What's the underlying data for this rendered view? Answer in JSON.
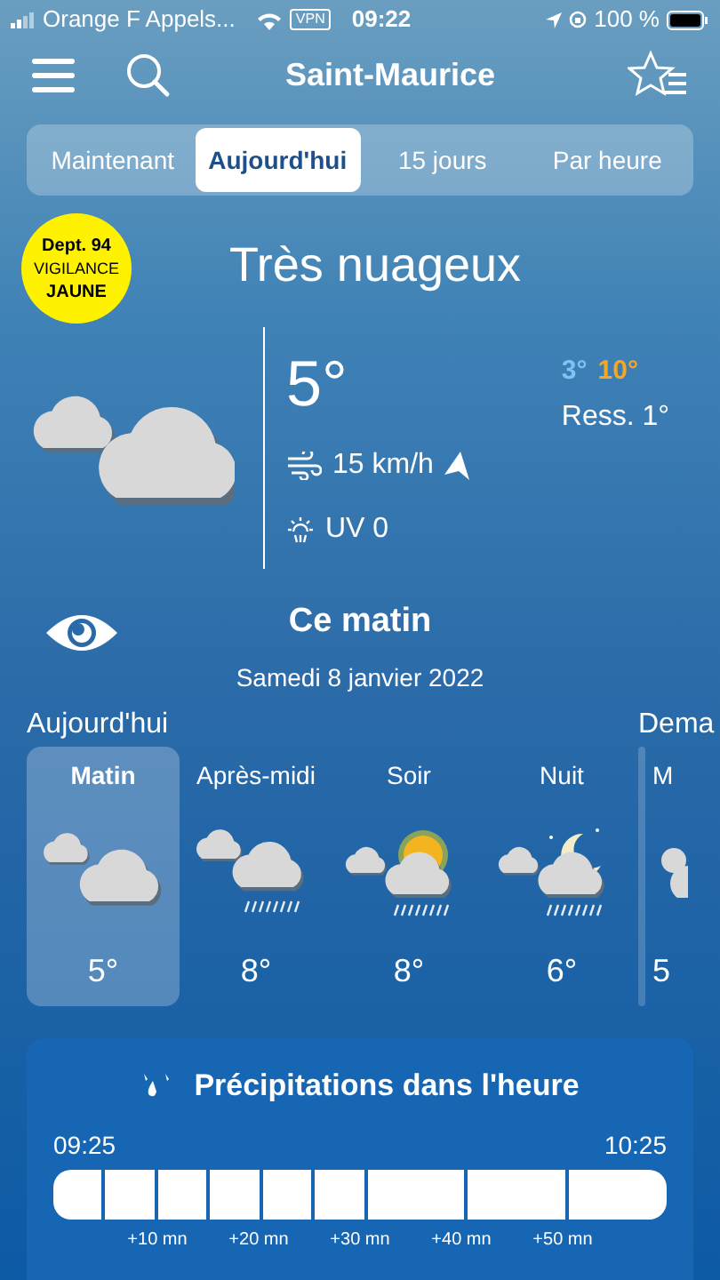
{
  "status_bar": {
    "carrier": "Orange F Appels...",
    "vpn": "VPN",
    "time": "09:22",
    "battery": "100 %"
  },
  "header": {
    "title": "Saint-Maurice"
  },
  "tabs": [
    {
      "label": "Maintenant",
      "selected": false
    },
    {
      "label": "Aujourd'hui",
      "selected": true
    },
    {
      "label": "15 jours",
      "selected": false
    },
    {
      "label": "Par heure",
      "selected": false
    }
  ],
  "alert": {
    "lines": [
      "Dept. 94",
      "VIGILANCE",
      "JAUNE"
    ]
  },
  "current": {
    "condition": "Très nuageux",
    "temperature": "5°",
    "min": "3°",
    "max": "10°",
    "feels_like": "Ress. 1°",
    "wind": "15 km/h",
    "uv": "UV 0"
  },
  "section": {
    "title": "Ce matin",
    "date": "Samedi 8 janvier 2022"
  },
  "days": [
    {
      "label": "Aujourd'hui",
      "periods": [
        {
          "name": "Matin",
          "temperature": "5°",
          "selected": true,
          "kind": "cloudy"
        },
        {
          "name": "Après-midi",
          "temperature": "8°",
          "selected": false,
          "kind": "rain"
        },
        {
          "name": "Soir",
          "temperature": "8°",
          "selected": false,
          "kind": "sun-rain"
        },
        {
          "name": "Nuit",
          "temperature": "6°",
          "selected": false,
          "kind": "night-rain"
        }
      ]
    },
    {
      "label": "Dema",
      "periods": [
        {
          "name": "M",
          "temperature": "5",
          "selected": false
        }
      ]
    }
  ],
  "precipitation": {
    "title": "Précipitations dans l'heure",
    "start": "09:25",
    "end": "10:25",
    "ticks": [
      "+10 mn",
      "+20 mn",
      "+30 mn",
      "+40 mn",
      "+50 mn"
    ]
  }
}
